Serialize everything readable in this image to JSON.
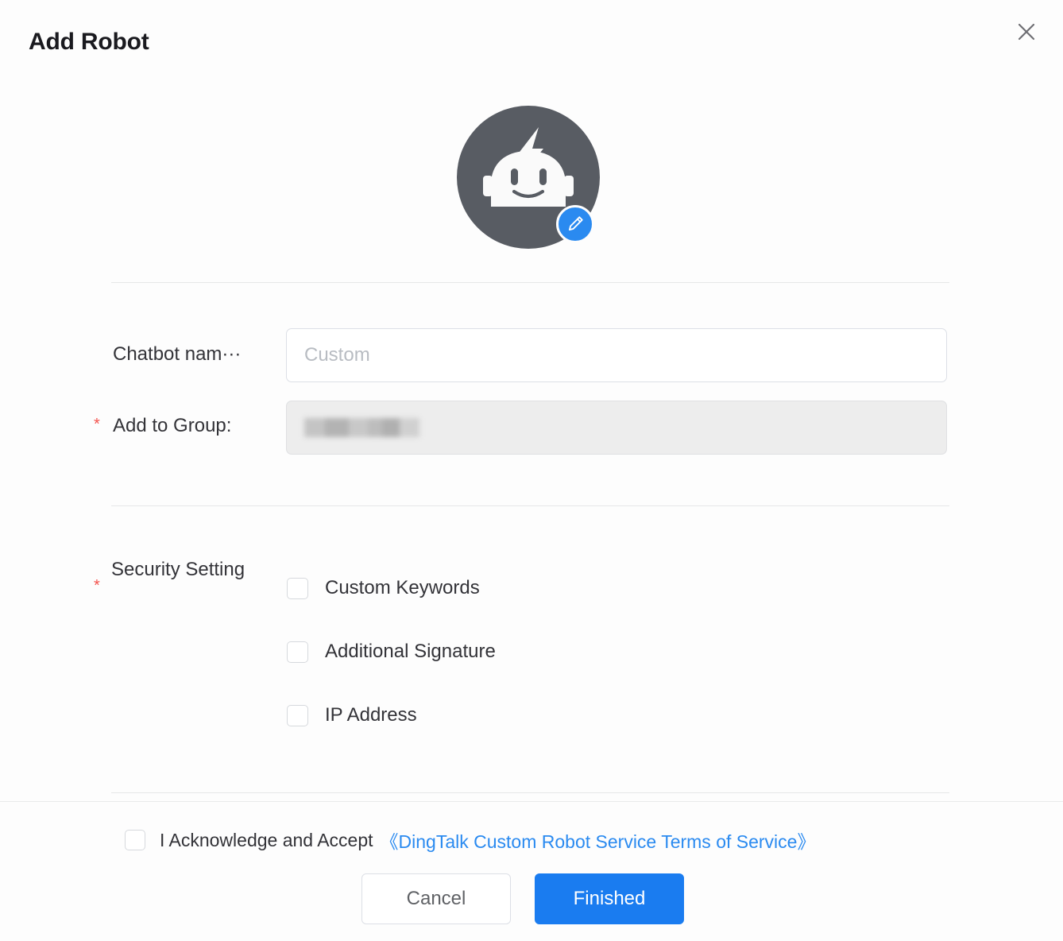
{
  "dialog": {
    "title": "Add Robot",
    "close_icon": "close-icon"
  },
  "avatar": {
    "icon": "robot-avatar-icon",
    "edit_badge_icon": "pencil-edit-icon",
    "circle_color": "#585c63",
    "badge_color": "#2a8af0"
  },
  "form": {
    "fields": [
      {
        "label": "Chatbot nam···",
        "required": false,
        "placeholder": "Custom",
        "value": "",
        "disabled": false
      },
      {
        "label": "Add to Group:",
        "required": true,
        "required_marker": "*",
        "placeholder": "",
        "value": "",
        "disabled": true,
        "redacted": true
      }
    ]
  },
  "security": {
    "label": "Security Setting",
    "required": true,
    "required_marker": "*",
    "options": [
      {
        "label": "Custom Keywords",
        "checked": false
      },
      {
        "label": "Additional Signature",
        "checked": false
      },
      {
        "label": "IP Address",
        "checked": false
      }
    ]
  },
  "footer": {
    "acknowledge": {
      "checked": false,
      "text": "I Acknowledge and Accept",
      "link_text": "《DingTalk Custom Robot Service Terms of Service》",
      "link_color": "#2a8af0"
    },
    "buttons": {
      "cancel_label": "Cancel",
      "finished_label": "Finished",
      "primary_color": "#1a7cf0"
    }
  }
}
